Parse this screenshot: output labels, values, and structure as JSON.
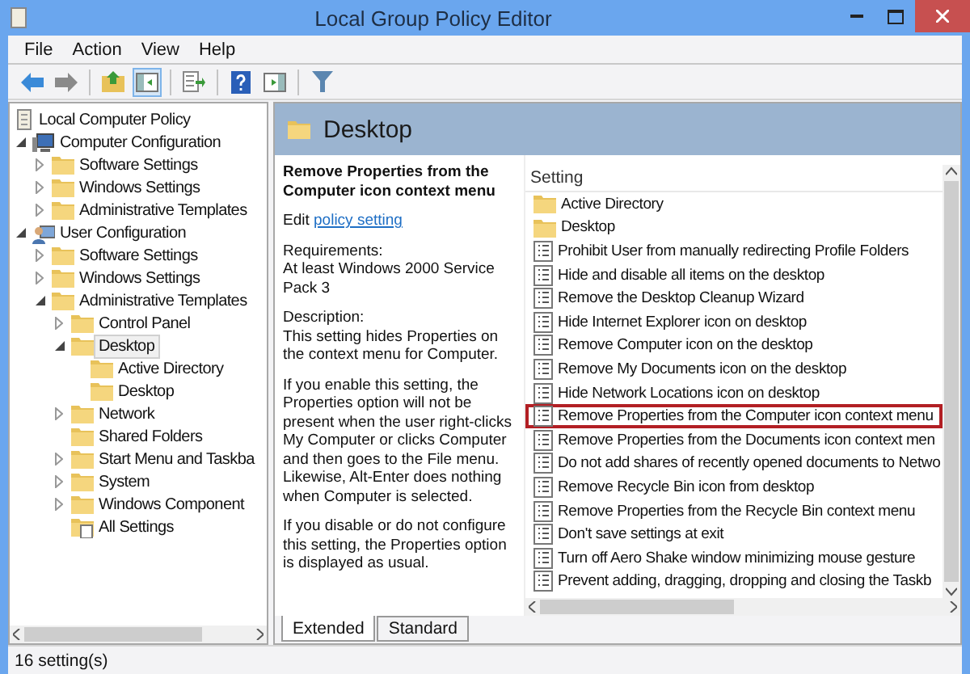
{
  "window": {
    "title": "Local Group Policy Editor"
  },
  "menu": [
    "File",
    "Action",
    "View",
    "Help"
  ],
  "toolbar": [
    [
      {
        "kind": "back",
        "pressed": false
      },
      {
        "kind": "forward",
        "pressed": false
      }
    ],
    [
      {
        "kind": "up",
        "pressed": false
      },
      {
        "kind": "tree",
        "pressed": true
      }
    ],
    [
      {
        "kind": "export",
        "pressed": false
      }
    ],
    [
      {
        "kind": "help",
        "pressed": false
      },
      {
        "kind": "pane",
        "pressed": false
      }
    ],
    [
      {
        "kind": "filter",
        "pressed": false
      }
    ]
  ],
  "tree": [
    {
      "label": "Local Computer Policy",
      "kind": "policy",
      "selected": false,
      "children": [
        {
          "label": "Computer Configuration",
          "kind": "computer",
          "expanded": true,
          "selected": false,
          "children": [
            {
              "label": "Software Settings",
              "kind": "folder",
              "expanded": false,
              "selected": false
            },
            {
              "label": "Windows Settings",
              "kind": "folder",
              "expanded": false,
              "selected": false
            },
            {
              "label": "Administrative Templates",
              "kind": "folder",
              "expanded": false,
              "selected": false
            }
          ]
        },
        {
          "label": "User Configuration",
          "kind": "user",
          "expanded": true,
          "selected": false,
          "children": [
            {
              "label": "Software Settings",
              "kind": "folder",
              "expanded": false,
              "selected": false
            },
            {
              "label": "Windows Settings",
              "kind": "folder",
              "expanded": false,
              "selected": false
            },
            {
              "label": "Administrative Templates",
              "kind": "folder",
              "expanded": true,
              "selected": false,
              "children": [
                {
                  "label": "Control Panel",
                  "kind": "folder",
                  "expanded": false,
                  "selected": false
                },
                {
                  "label": "Desktop",
                  "kind": "folder",
                  "expanded": true,
                  "selected": true,
                  "children": [
                    {
                      "label": "Active Directory",
                      "kind": "folder",
                      "selected": false
                    },
                    {
                      "label": "Desktop",
                      "kind": "folder",
                      "selected": false
                    }
                  ]
                },
                {
                  "label": "Network",
                  "kind": "folder",
                  "expanded": false,
                  "selected": false
                },
                {
                  "label": "Shared Folders",
                  "kind": "folder",
                  "selected": false
                },
                {
                  "label": "Start Menu and Taskba",
                  "kind": "folder",
                  "expanded": false,
                  "selected": false
                },
                {
                  "label": "System",
                  "kind": "folder",
                  "expanded": false,
                  "selected": false
                },
                {
                  "label": "Windows Component",
                  "kind": "folder",
                  "expanded": false,
                  "selected": false
                },
                {
                  "label": "All Settings",
                  "kind": "settings",
                  "selected": false
                }
              ]
            }
          ]
        }
      ]
    }
  ],
  "header": {
    "title": "Desktop"
  },
  "details": {
    "title": "Remove Properties from the Computer icon context menu",
    "edit_prefix": "Edit",
    "edit_link": "policy setting",
    "requirements_label": "Requirements:",
    "requirements": "At least Windows 2000 Service Pack 3",
    "description_label": "Description:",
    "paragraphs": [
      "This setting hides Properties on the context menu for Computer.",
      "If you enable this setting, the Properties option will not be present when the user right-clicks My Computer or clicks Computer and then goes to the File menu.  Likewise, Alt-Enter does nothing when Computer is selected.",
      "If you disable or do not configure this setting, the Properties option is displayed as usual."
    ]
  },
  "settings": {
    "column": "Setting",
    "rows": [
      {
        "kind": "folder",
        "text": "Active Directory",
        "selected": false
      },
      {
        "kind": "folder",
        "text": "Desktop",
        "selected": false
      },
      {
        "kind": "policy",
        "text": "Prohibit User from manually redirecting Profile Folders",
        "selected": false
      },
      {
        "kind": "policy",
        "text": "Hide and disable all items on the desktop",
        "selected": false
      },
      {
        "kind": "policy",
        "text": "Remove the Desktop Cleanup Wizard",
        "selected": false
      },
      {
        "kind": "policy",
        "text": "Hide Internet Explorer icon on desktop",
        "selected": false
      },
      {
        "kind": "policy",
        "text": "Remove Computer icon on the desktop",
        "selected": false
      },
      {
        "kind": "policy",
        "text": "Remove My Documents icon on the desktop",
        "selected": false
      },
      {
        "kind": "policy",
        "text": "Hide Network Locations icon on desktop",
        "selected": false
      },
      {
        "kind": "policy",
        "text": "Remove Properties from the Computer icon context menu",
        "selected": true
      },
      {
        "kind": "policy",
        "text": "Remove Properties from the Documents icon context men",
        "selected": false
      },
      {
        "kind": "policy",
        "text": "Do not add shares of recently opened documents to Netwo",
        "selected": false
      },
      {
        "kind": "policy",
        "text": "Remove Recycle Bin icon from desktop",
        "selected": false
      },
      {
        "kind": "policy",
        "text": "Remove Properties from the Recycle Bin context menu",
        "selected": false
      },
      {
        "kind": "policy",
        "text": "Don't save settings at exit",
        "selected": false
      },
      {
        "kind": "policy",
        "text": "Turn off Aero Shake window minimizing mouse gesture",
        "selected": false
      },
      {
        "kind": "policy",
        "text": "Prevent adding, dragging, dropping and closing the Taskb",
        "selected": false
      }
    ]
  },
  "tabs": [
    {
      "label": "Extended",
      "selected": true
    },
    {
      "label": "Standard",
      "selected": false
    }
  ],
  "status_bar": {
    "text": "16 setting(s)"
  }
}
